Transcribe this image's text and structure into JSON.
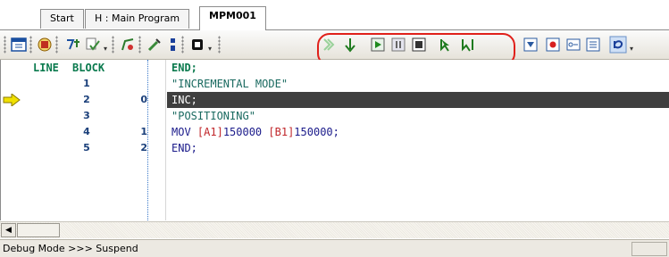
{
  "tabs": [
    {
      "label": "Start"
    },
    {
      "label": "H : Main Program"
    },
    {
      "label": "MPM001",
      "active": true
    }
  ],
  "toolbar": {
    "icons": [
      "program-window-icon",
      "transfer-icon",
      "compile-icon",
      "check-icon",
      "edit-mode-icon",
      "jog-icon",
      "debug-toggle-icon",
      "hold-icon",
      "step-icon",
      "run-icon",
      "pause-icon",
      "stop-icon",
      "step-in-icon",
      "run-to-cursor-icon",
      "watch-icon",
      "breakpoint-icon",
      "io-monitor-icon",
      "register-list-icon",
      "refresh-icon"
    ],
    "highlight_color": "#e0201a"
  },
  "editor": {
    "col_line": "LINE",
    "col_block": "BLOCK",
    "first_line": "END;",
    "rows": [
      {
        "line": "1",
        "block": "",
        "code": "\"INCREMENTAL MODE\"",
        "kind": "comment"
      },
      {
        "line": "2",
        "block": "0",
        "code": "INC;",
        "kind": "current"
      },
      {
        "line": "3",
        "block": "",
        "code": "\"POSITIONING\"",
        "kind": "comment"
      },
      {
        "line": "4",
        "block": "1",
        "code_parts": [
          "MOV ",
          "[A1]",
          "150000 ",
          "[B1]",
          "150000;"
        ],
        "kind": "command"
      },
      {
        "line": "5",
        "block": "2",
        "code": "END;",
        "kind": "command"
      }
    ]
  },
  "colors": {
    "keyword": "#1a1a8a",
    "comment": "#1a6a60",
    "axis": "#c0262a",
    "selection": "#3f3f3f",
    "pointer": "#f0e000"
  },
  "status": {
    "text": "Debug Mode  >>> Suspend"
  }
}
